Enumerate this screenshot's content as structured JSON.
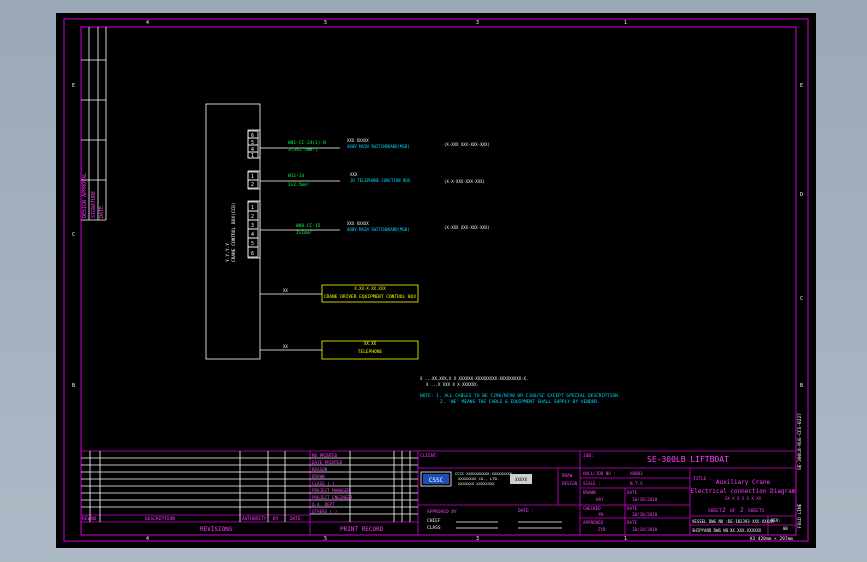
{
  "colors": {
    "paper": "#000000",
    "frame": "#d400d4",
    "ink": "#ffffff",
    "cable": "#00ff3c",
    "note": "#00d8ff",
    "box": "#ffff00",
    "title": "#ff40ff"
  },
  "zones": {
    "top": [
      "4",
      "5",
      "3",
      "1"
    ],
    "left": [
      "E",
      "C",
      "B"
    ],
    "right": [
      "E",
      "D",
      "C",
      "B"
    ]
  },
  "left_strip": [
    "DESIGN APPROVAL",
    "SIGNATURE",
    "DATE"
  ],
  "right_strip": [
    "SE-300LB-RUG-CCS-0227",
    "FOLD LINE"
  ],
  "device": {
    "label": "CRANE CONTROL BOX(CCB)",
    "tag": "Y.Y.Y.Y"
  },
  "terminal_groups": [
    {
      "terminals": [
        "6",
        "5",
        "4",
        "1"
      ],
      "cable_id": "W01-CC-24(1)-B",
      "cable_spec": "3(3x2.5mm²)",
      "dest_code": "XXX  XXXXX",
      "dest_desc": "400V MAIN SWITCHBOARD(MSB)",
      "dest_ref": "(X-XXX  XXX-XXX-XXX)"
    },
    {
      "terminals": [
        "1",
        "2"
      ],
      "cable_id": "W11-14",
      "cable_spec": "2x2.5mm²",
      "dest_code": "XXX",
      "dest_desc": "JB TELEPHONE JUNCTION BOX",
      "dest_ref": "(X-X-XXX-XXX-XXX)"
    },
    {
      "terminals": [
        "1",
        "2",
        "3",
        "4",
        "5",
        "6"
      ],
      "cable_id": "W08-CC-15",
      "cable_spec": "2x1mm²",
      "dest_code": "XXX  XXXXX",
      "dest_desc": "400V MAIN SWITCHBOARD(MSB)",
      "dest_ref": "(X-XXX  XXX-XXX-XXX)"
    }
  ],
  "boxes": [
    {
      "tag": "X.XX-X-XX.XXX",
      "label": "CRANE DRIVER EQUIPMENT CONTROL BOX",
      "wire": "XX"
    },
    {
      "tag": "XX.XX",
      "label": "TELEPHONE",
      "wire": "XX"
    }
  ],
  "notes": {
    "line0": "X  ...XX,XXX,X X   XXXXXX-XXXXXXXXX-XXXXXXXXX-X.",
    "line0b": "X  ...X XXX X X XXXXXX.",
    "line1": "NOTE: 1. ALL CABLES TO BE CJ96/NC90 OR CJ86/SC EXCEPT SPECIAL DESCRIPTION.",
    "line2": "2. 'WE' MEANS THE CABLE & EQUIPMENT SHALL SUPPLY BY VENDOR."
  },
  "revisions": {
    "col_rev": "REV",
    "col_no": "NO",
    "col_desc": "DESCRIPTION",
    "col_auth": "AUTHORITY",
    "col_by": "BY",
    "col_date": "DATE",
    "footer": "REVISIONS"
  },
  "print_record": {
    "items": [
      "NO PRINTED",
      "DATE PRINTED",
      "REASON",
      "DRAWN",
      "CLASS (           )",
      "PROJECT MANAGER",
      "PROJECT ENGINEER",
      "Q.A. DEPT",
      "OTHERS (          )"
    ],
    "footer": "PRINT RECORD"
  },
  "client": {
    "label": "CLIENT:",
    "company_logo": "CSSC",
    "company_line1": "CCCC  XXXXXXXXXX-XXXXXXXXX",
    "company_line2": "XXXXXXXX CO., LTD.",
    "company_line3": "XXXXXXX XXXXXXXX",
    "logo2": "XXXXX",
    "approved_by": "APPROVED BY",
    "date": "DATE :",
    "class_label1": "CHIEF",
    "class_label2": "CLASS"
  },
  "design_col": [
    "DRAW",
    "DESIGN"
  ],
  "job": {
    "label": "JOB:",
    "value": "SE-300LB LIFTBOAT"
  },
  "fields": {
    "hull_label": "HULL/JOB NO :",
    "hull_value": "H4003",
    "scale_label": "SCALE :",
    "scale_value": "N.T.S",
    "drawn_label": "DRAWN",
    "drawn_name": "HAY",
    "drawn_date_label": "DATE",
    "drawn_date": "10/18/2010",
    "checked_label": "CHECKED",
    "checked_name": "YN",
    "checked_date_label": "DATE",
    "checked_date": "10/18/2010",
    "approved_label": "APPROVED",
    "approved_name": "ZYB",
    "approved_date_label": "DATE",
    "approved_date": "10/18/2010"
  },
  "title_block": {
    "label": "TITLE :",
    "title1": "Auxiliary Crane",
    "title2": "Electrical connection Diagram",
    "title3": "XX X X X X X XX",
    "sheet_label": "SHEET",
    "sheet_no": "2",
    "sheet_of": "OF",
    "sheet_total": "2",
    "sheets_label": "SHEETS",
    "vessel_label": "VESSEL DWG NO :",
    "vessel_value": "DE-182393-XXX-XXXXX",
    "shipyard_label": "SHIPYARD DWG NO :",
    "shipyard_value": "XX.XXX.XXXXXX",
    "rev_label": "REV:",
    "rev_value": "00"
  },
  "size_note": "A3  420mm × 297mm"
}
